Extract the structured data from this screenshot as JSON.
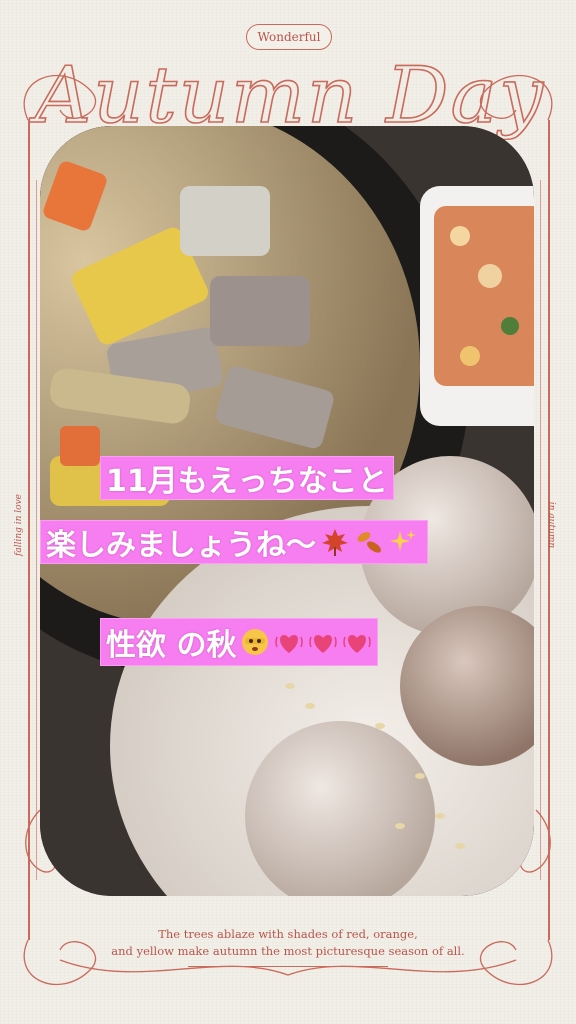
{
  "header": {
    "badge": "Wonderful",
    "title": "Autumn Day"
  },
  "side": {
    "left": "falling in love",
    "right": "in autumn"
  },
  "overlay": {
    "line1": "11月もえっちなこと",
    "line2": "楽しみましょうね〜",
    "line3": "性欲 の秋"
  },
  "emojis": {
    "line2": [
      "maple-leaf-icon",
      "falling-leaves-icon",
      "sparkles-icon"
    ],
    "line3": [
      "face-with-peeking-eye-icon",
      "beating-heart-icon",
      "beating-heart-icon",
      "beating-heart-icon"
    ]
  },
  "footer": {
    "line1": "The trees ablaze with shades of red, orange,",
    "line2": "and yellow make autumn the most picturesque season of all."
  },
  "colors": {
    "accent": "#c96a5a",
    "highlight": "#f77ef0",
    "paper": "#f2eee8"
  }
}
